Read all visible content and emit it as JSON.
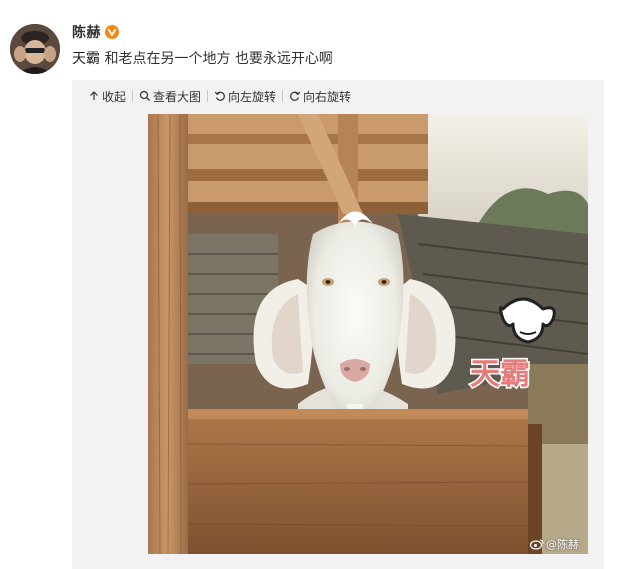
{
  "user": {
    "name": "陈赫",
    "avatar_icon": "user-avatar",
    "verified_icon": "verified-v-badge-icon",
    "verified_color": "#f08a17"
  },
  "post": {
    "text_highlight": "天霸",
    "text_rest": " 和老点在另一个地方 也要永远开心啊"
  },
  "media_toolbar": {
    "collapse_label": "收起",
    "view_large_label": "查看大图",
    "rotate_left_label": "向左旋转",
    "rotate_right_label": "向右旋转"
  },
  "photo": {
    "sticker_text": "天霸",
    "watermark_text": "@陈赫",
    "watermark_icon": "weibo-logo-icon"
  },
  "colors": {
    "card_background": "#f2f2f5",
    "text": "#333333"
  }
}
